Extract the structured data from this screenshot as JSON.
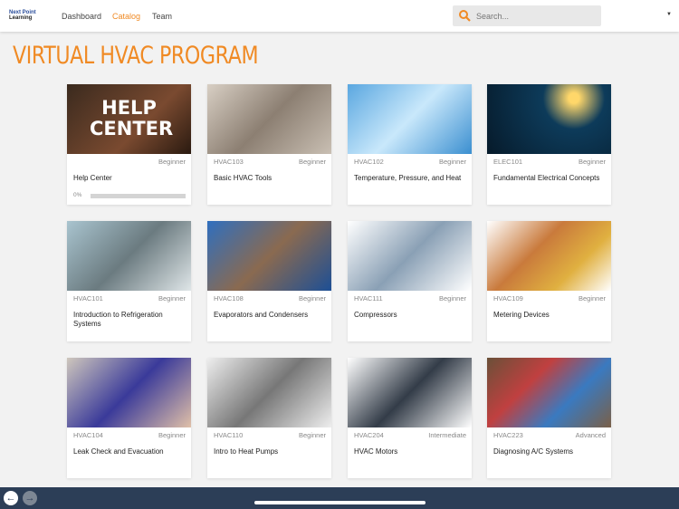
{
  "header": {
    "logo_line1": "Next Point",
    "logo_line2": "Learning",
    "nav": [
      "Dashboard",
      "Catalog",
      "Team"
    ],
    "active": "Catalog",
    "search_placeholder": "Search..."
  },
  "page_title": "VIRTUAL HVAC PROGRAM",
  "help_center_image_text": "HELP CENTER",
  "courses": [
    {
      "code": "",
      "level": "Beginner",
      "name": "Help Center",
      "progress": "0%"
    },
    {
      "code": "HVAC103",
      "level": "Beginner",
      "name": "Basic HVAC Tools"
    },
    {
      "code": "HVAC102",
      "level": "Beginner",
      "name": "Temperature, Pressure, and Heat"
    },
    {
      "code": "ELEC101",
      "level": "Beginner",
      "name": "Fundamental Electrical Concepts"
    },
    {
      "code": "HVAC101",
      "level": "Beginner",
      "name": "Introduction to Refrigeration Systems"
    },
    {
      "code": "HVAC108",
      "level": "Beginner",
      "name": "Evaporators and Condensers"
    },
    {
      "code": "HVAC111",
      "level": "Beginner",
      "name": "Compressors"
    },
    {
      "code": "HVAC109",
      "level": "Beginner",
      "name": "Metering Devices"
    },
    {
      "code": "HVAC104",
      "level": "Beginner",
      "name": "Leak Check and Evacuation"
    },
    {
      "code": "HVAC110",
      "level": "Beginner",
      "name": "Intro to Heat Pumps"
    },
    {
      "code": "HVAC204",
      "level": "Intermediate",
      "name": "HVAC Motors"
    },
    {
      "code": "HVAC223",
      "level": "Advanced",
      "name": "Diagnosing A/C Systems"
    }
  ],
  "colors": {
    "accent": "#f08a24",
    "bottom_bar": "#2c3e57"
  }
}
